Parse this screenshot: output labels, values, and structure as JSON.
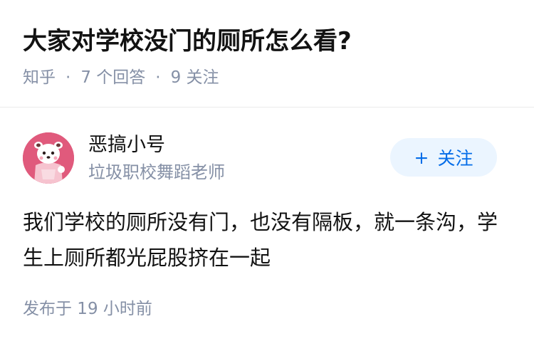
{
  "question": {
    "title": "大家对学校没门的厕所怎么看?",
    "source": "知乎",
    "separator": "·",
    "answer_count": "7 个回答",
    "follower_count": "9 关注"
  },
  "answer": {
    "author": {
      "name": "恶搞小号",
      "bio": "垃圾职校舞蹈老师",
      "avatar_icon": "cartoon-avatar"
    },
    "follow_button": {
      "plus": "+",
      "label": "关注"
    },
    "content": "我们学校的厕所没有门，也没有隔板，就一条沟，学生上厕所都光屁股挤在一起",
    "publish_time": "发布于 19 小时前"
  },
  "colors": {
    "title": "#121212",
    "meta": "#8590a6",
    "accent": "#056de8",
    "button_bg": "#ebf5ff",
    "avatar_bg": "#e05a7c"
  }
}
